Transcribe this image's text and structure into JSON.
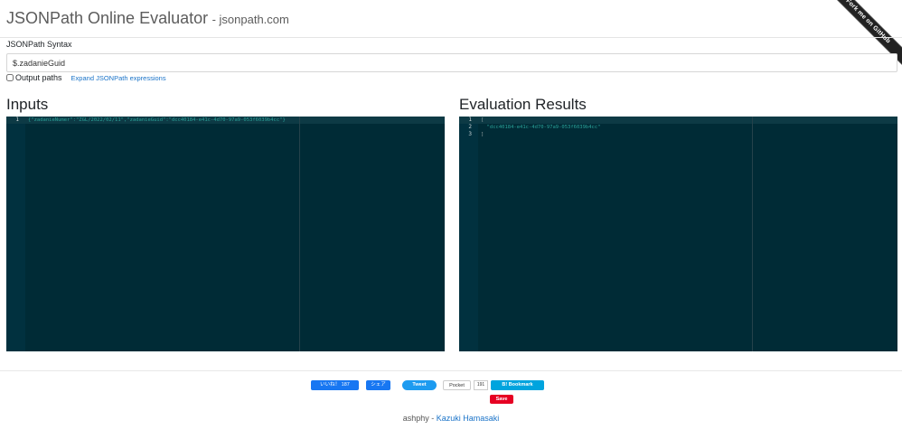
{
  "header": {
    "title": "JSONPath Online Evaluator",
    "subtitle": "- jsonpath.com"
  },
  "ribbon": {
    "label": "Fork me on GitHub"
  },
  "syntax": {
    "label": "JSONPath Syntax",
    "value": "$.zadanieGuid"
  },
  "options": {
    "output_paths_label": "Output paths",
    "output_paths_checked": false,
    "expand_link": "Expand JSONPath expressions"
  },
  "inputs": {
    "title": "Inputs",
    "lines": [
      {
        "num": "1",
        "text": "{\"zadanieNumer\":\"ZGL/2022/02/11\",\"zadanieGuid\":\"dcc40184-e41c-4d70-97a9-053f6039b4cc\"}"
      }
    ]
  },
  "results": {
    "title": "Evaluation Results",
    "lines": [
      {
        "num": "1",
        "text": "["
      },
      {
        "num": "2",
        "text": "  \"dcc40184-e41c-4d70-97a9-053f6039b4cc\""
      },
      {
        "num": "3",
        "text": "]"
      }
    ]
  },
  "social": {
    "facebook_like": "いいね！ 187",
    "facebook_share": "シェア",
    "tweet": "Tweet",
    "pocket": "Pocket",
    "pocket_count": "191",
    "hatena": "B! Bookmark",
    "pinterest": "Save"
  },
  "footer": {
    "author": "ashphy -",
    "link": "Kazuki Hamasaki"
  },
  "colors": {
    "editor_bg": "#002b36",
    "string": "#2aa198",
    "link": "#1a73c8"
  }
}
